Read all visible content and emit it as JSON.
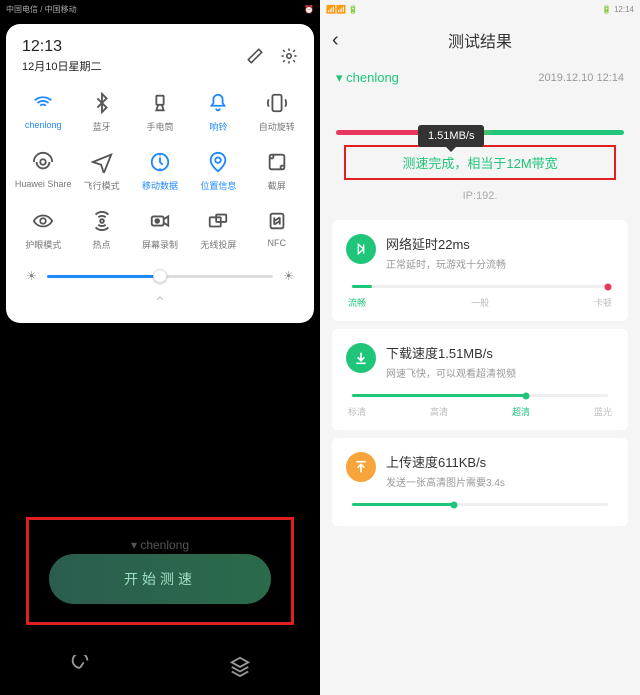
{
  "left": {
    "status": {
      "carrier": "中国电信 / 中国移动",
      "icons": "⏰"
    },
    "time": "12:13",
    "date": "12月10日星期二",
    "tiles": [
      {
        "label": "chenlong",
        "active": true
      },
      {
        "label": "蓝牙"
      },
      {
        "label": "手电筒"
      },
      {
        "label": "响铃",
        "active": true
      },
      {
        "label": "自动旋转"
      },
      {
        "label": "Huawei Share"
      },
      {
        "label": "飞行模式"
      },
      {
        "label": "移动数据",
        "active": true
      },
      {
        "label": "位置信息",
        "active": true
      },
      {
        "label": "截屏"
      },
      {
        "label": "护眼模式"
      },
      {
        "label": "热点"
      },
      {
        "label": "屏幕录制"
      },
      {
        "label": "无线投屏"
      },
      {
        "label": "NFC"
      }
    ],
    "ssid": "chenlong",
    "start_label": "开始测速"
  },
  "right": {
    "status_time": "12:14",
    "title": "测试结果",
    "ssid": "chenlong",
    "datetime": "2019.12.10 12:14",
    "speed_tooltip": "1.51MB/s",
    "result_prefix": "测速完成，相当于",
    "result_hl": "12M带宽",
    "ip": "IP:192.",
    "cards": [
      {
        "title": "网络延时22ms",
        "sub": "正常延时，玩游戏十分流畅",
        "scale": [
          "流畅",
          "一般",
          "卡顿"
        ],
        "scale_on": 0,
        "fill": "8%",
        "fill_color": "#1fc67a",
        "dot_color": "#e8365e",
        "dot_pos": "100%",
        "icon": "latency"
      },
      {
        "title": "下载速度1.51MB/s",
        "sub": "网速飞快，可以观看超清视频",
        "scale": [
          "标清",
          "高清",
          "超清",
          "蓝光"
        ],
        "scale_on": 2,
        "fill": "68%",
        "fill_color": "#1fc67a",
        "dot_color": "#1fc67a",
        "dot_pos": "68%",
        "icon": "download"
      },
      {
        "title": "上传速度611KB/s",
        "sub": "发送一张高清图片需要3.4s",
        "scale": [
          "",
          "",
          "",
          ""
        ],
        "scale_on": 1,
        "fill": "40%",
        "fill_color": "#1fc67a",
        "dot_color": "#1fc67a",
        "dot_pos": "40%",
        "icon": "upload"
      }
    ]
  }
}
